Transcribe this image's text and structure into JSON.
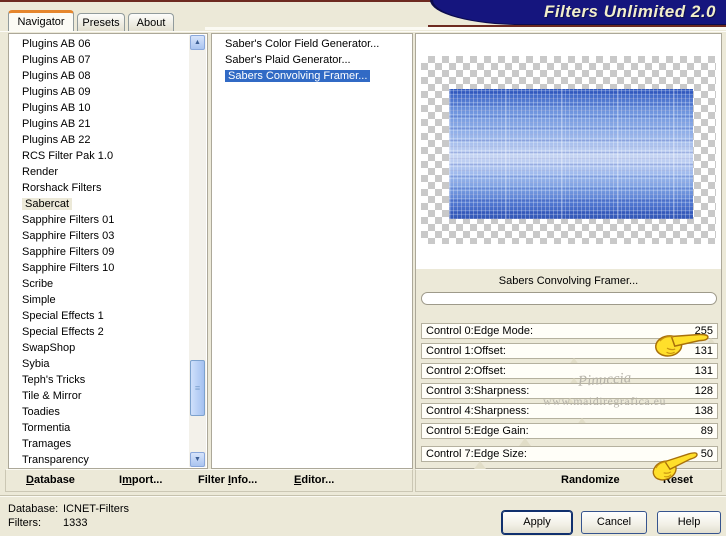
{
  "banner": {
    "title": "Filters Unlimited 2.0"
  },
  "tabs": {
    "navigator": "Navigator",
    "presets": "Presets",
    "about": "About"
  },
  "categories": {
    "items": [
      {
        "label": "Plugins AB 06"
      },
      {
        "label": "Plugins AB 07"
      },
      {
        "label": "Plugins AB 08"
      },
      {
        "label": "Plugins AB 09"
      },
      {
        "label": "Plugins AB 10"
      },
      {
        "label": "Plugins AB 21"
      },
      {
        "label": "Plugins AB 22"
      },
      {
        "label": "RCS Filter Pak 1.0"
      },
      {
        "label": "Render"
      },
      {
        "label": "Rorshack Filters"
      },
      {
        "label": "Sabercat",
        "selected": true
      },
      {
        "label": "Sapphire Filters 01"
      },
      {
        "label": "Sapphire Filters 03"
      },
      {
        "label": "Sapphire Filters 09"
      },
      {
        "label": "Sapphire Filters 10"
      },
      {
        "label": "Scribe"
      },
      {
        "label": "Simple"
      },
      {
        "label": "Special Effects 1"
      },
      {
        "label": "Special Effects 2"
      },
      {
        "label": "SwapShop"
      },
      {
        "label": "Sybia"
      },
      {
        "label": "Teph's Tricks"
      },
      {
        "label": "Tile & Mirror"
      },
      {
        "label": "Toadies"
      },
      {
        "label": "Tormentia"
      },
      {
        "label": "Tramages"
      },
      {
        "label": "Transparency"
      }
    ]
  },
  "filters": {
    "items": [
      {
        "label": "Saber's Color Field Generator..."
      },
      {
        "label": "Saber's Plaid Generator..."
      },
      {
        "label": "Sabers Convolving Framer...",
        "selected": true
      }
    ]
  },
  "toolbar": {
    "database": {
      "pre": "",
      "key": "D",
      "rest": "atabase"
    },
    "import": {
      "pre": "I",
      "key": "m",
      "rest": "port..."
    },
    "filter_info": {
      "pre": "Filter ",
      "key": "I",
      "rest": "nfo..."
    },
    "editor": {
      "pre": "",
      "key": "E",
      "rest": "ditor..."
    }
  },
  "preview": {
    "caption": "Sabers Convolving Framer..."
  },
  "controls": {
    "max": 255,
    "rows": [
      {
        "label": "Control 0:Edge Mode:",
        "value": 255
      },
      {
        "label": "Control 1:Offset:",
        "value": 131
      },
      {
        "label": "Control 2:Offset:",
        "value": 131
      },
      {
        "label": "Control 3:Sharpness:",
        "value": 128
      },
      {
        "label": "Control 4:Sharpness:",
        "value": 138
      },
      {
        "label": "Control 5:Edge Gain:",
        "value": 89
      },
      {
        "label": "Control 7:Edge Size:",
        "value": 50
      }
    ]
  },
  "actions": {
    "randomize": "Randomize",
    "reset": "Reset"
  },
  "buttons": {
    "apply": "Apply",
    "cancel": "Cancel",
    "help": "Help"
  },
  "status": {
    "database_label": "Database:",
    "database_value": "ICNET-Filters",
    "filters_label": "Filters:",
    "filters_value": "1333"
  },
  "watermark": {
    "line1": "Pinuccia",
    "line2": "www.maidiregrafica.eu"
  },
  "scrollbar": {
    "up": "▲",
    "down": "▼",
    "grip": "≡"
  },
  "colors": {
    "banner_navy": "#15157e",
    "maroon_edge": "#6d2a20",
    "selection_blue": "#316ac5",
    "window_beige": "#ece9d8",
    "tab_accent_orange": "#e5862d"
  }
}
